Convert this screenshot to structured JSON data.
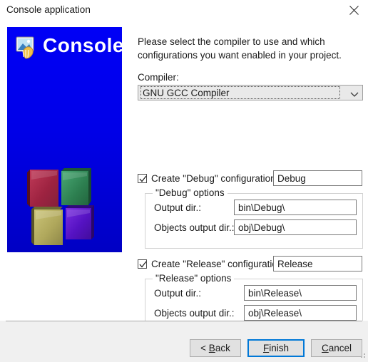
{
  "window": {
    "title": "Console application",
    "close_icon": "close-icon"
  },
  "banner": {
    "title": "Console",
    "icon": "image-picture-icon",
    "background_color": "#0000f0",
    "cubes": [
      {
        "name": "cube-red",
        "color": "#a32844"
      },
      {
        "name": "cube-green",
        "color": "#2e8b57"
      },
      {
        "name": "cube-olive",
        "color": "#b5ad5e"
      },
      {
        "name": "cube-purple",
        "color": "#5a12c8"
      }
    ]
  },
  "main": {
    "intro": "Please select the compiler to use and which configurations you want enabled in your project.",
    "compiler": {
      "label": "Compiler:",
      "selected": "GNU GCC Compiler",
      "arrow_icon": "chevron-down-icon"
    },
    "debug": {
      "checkbox_label": "Create \"Debug\" configuration:",
      "checked": true,
      "name_value": "Debug",
      "group_legend": "\"Debug\" options",
      "output_dir_label": "Output dir.:",
      "output_dir_value": "bin\\Debug\\",
      "objects_dir_label": "Objects output dir.:",
      "objects_dir_value": "obj\\Debug\\"
    },
    "release": {
      "checkbox_label": "Create \"Release\" configuration:",
      "checked": true,
      "name_value": "Release",
      "group_legend": "\"Release\" options",
      "output_dir_label": "Output dir.:",
      "output_dir_value": "bin\\Release\\",
      "objects_dir_label": "Objects output dir.:",
      "objects_dir_value": "obj\\Release\\"
    }
  },
  "footer": {
    "back": {
      "prefix": "< ",
      "mnemonic": "B",
      "rest": "ack"
    },
    "finish": {
      "mnemonic": "F",
      "rest": "inish",
      "focused": true,
      "focus_color": "#0078d7"
    },
    "cancel": {
      "mnemonic": "C",
      "rest": "ancel"
    }
  }
}
